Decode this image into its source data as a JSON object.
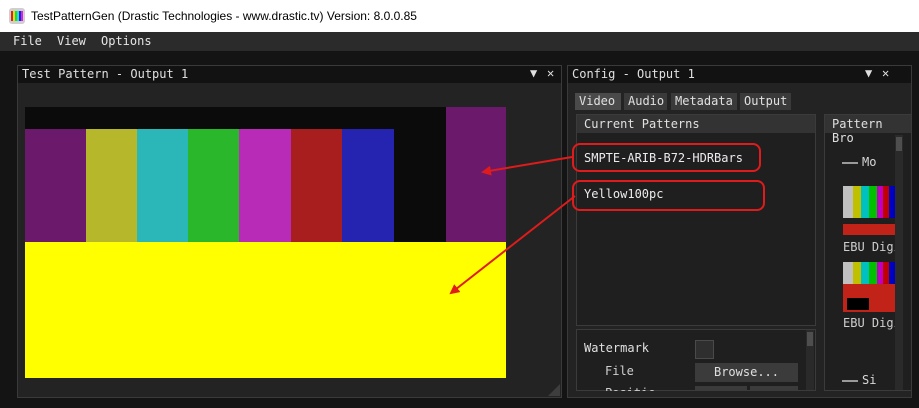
{
  "window": {
    "title": "TestPatternGen (Drastic Technologies - www.drastic.tv)  Version: 8.0.0.85"
  },
  "menu": {
    "items": [
      "File",
      "View",
      "Options"
    ]
  },
  "panel_left": {
    "title": "Test Pattern - Output 1",
    "pin_glyph": "▼",
    "close_glyph": "✕"
  },
  "panel_right": {
    "title": "Config - Output 1",
    "pin_glyph": "▼",
    "close_glyph": "✕",
    "tabs": [
      "Video",
      "Audio",
      "Metadata",
      "Output"
    ],
    "current_patterns": {
      "header": "Current Patterns",
      "items": [
        "SMPTE-ARIB-B72-HDRBars",
        "Yellow100pc"
      ]
    },
    "watermark": {
      "label": "Watermark",
      "file_label": "File",
      "position_label": "Positio",
      "browse_label": "Browse..."
    },
    "pattern_browser": {
      "header": "Pattern Bro",
      "mode_label": "Mo",
      "items": [
        "EBU Digi",
        "EBU Digi"
      ],
      "size_label": "Si"
    }
  },
  "bar_colors": [
    "#6b1a6b",
    "#b7b72b",
    "#2bb7b7",
    "#2bb72b",
    "#b72bb7",
    "#a81e1e",
    "#2424b0",
    "#0b0b0b",
    "#6b1a6b"
  ],
  "colors": {
    "callout": "#e01b1b",
    "yellow": "#ffff00"
  }
}
